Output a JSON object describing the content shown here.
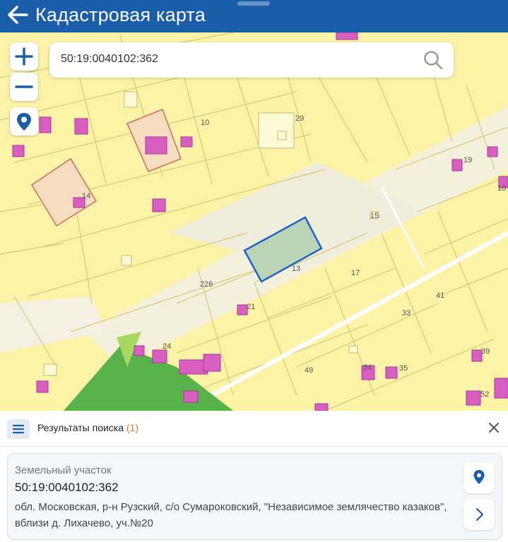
{
  "header": {
    "title": "Кадастровая карта"
  },
  "search": {
    "value": "50:19:0040102:362"
  },
  "map": {
    "labels": [
      "10",
      "29",
      "14",
      "226",
      "21",
      "24",
      "15",
      "13",
      "17",
      "33",
      "41",
      "19",
      "39",
      "34",
      "35",
      "49",
      "52",
      "10"
    ]
  },
  "results": {
    "label": "Результаты поиска",
    "count": "(1)"
  },
  "result_card": {
    "type": "Земельный участок",
    "cadastral_number": "50:19:0040102:362",
    "address": "обл. Московская, р-н Рузский, с/о Сумароковский, \"Независимое землячество казаков\", вблизи д. Лихачево, уч.№20"
  },
  "colors": {
    "header": "#1a5da8",
    "parcel_fill": "#fdf6a8",
    "building": "#d85ec0",
    "selected": "#1e64c8"
  }
}
